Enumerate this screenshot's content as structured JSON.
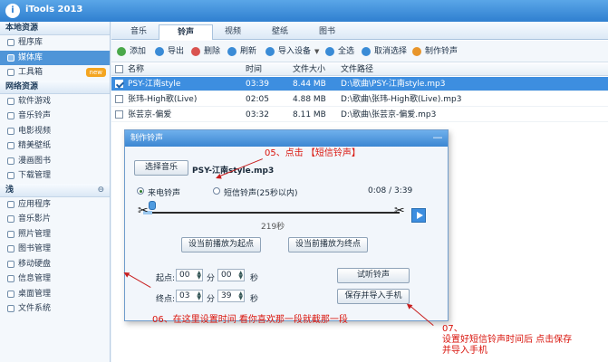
{
  "app": {
    "title": "iTools 2013",
    "logo_icon": "itools-logo"
  },
  "sidebar": {
    "sections": [
      {
        "label": "本地资源",
        "items": [
          {
            "label": "程序库",
            "icon": "app-library-icon",
            "active": false
          },
          {
            "label": "媒体库",
            "icon": "media-library-icon",
            "active": true
          },
          {
            "label": "工具箱",
            "icon": "toolbox-icon",
            "active": false,
            "badge": "new"
          }
        ]
      },
      {
        "label": "网络资源",
        "items": [
          {
            "label": "软件游戏",
            "icon": "games-icon",
            "active": false
          },
          {
            "label": "音乐铃声",
            "icon": "music-ringtone-icon",
            "active": false
          },
          {
            "label": "电影视频",
            "icon": "video-icon",
            "active": false
          },
          {
            "label": "精美壁纸",
            "icon": "wallpaper-icon",
            "active": false
          },
          {
            "label": "漫画图书",
            "icon": "comics-icon",
            "active": false
          },
          {
            "label": "下载管理",
            "icon": "download-icon",
            "active": false
          }
        ]
      },
      {
        "label": "浅",
        "items": [
          {
            "label": "应用程序",
            "icon": "apps-icon",
            "active": false
          },
          {
            "label": "音乐影片",
            "icon": "music-video-icon",
            "active": false
          },
          {
            "label": "照片管理",
            "icon": "photo-icon",
            "active": false
          },
          {
            "label": "图书管理",
            "icon": "book-icon",
            "active": false
          },
          {
            "label": "移动硬盘",
            "icon": "disk-icon",
            "active": false
          },
          {
            "label": "信息管理",
            "icon": "message-icon",
            "active": false
          },
          {
            "label": "桌面管理",
            "icon": "desktop-icon",
            "active": false
          },
          {
            "label": "文件系统",
            "icon": "filesystem-icon",
            "active": false
          }
        ]
      }
    ]
  },
  "tabs": [
    "音乐",
    "铃声",
    "视频",
    "壁纸",
    "图书"
  ],
  "active_tab": "铃声",
  "toolbar": {
    "add": "添加",
    "export": "导出",
    "delete": "删除",
    "refresh": "刷新",
    "import_device": "导入设备",
    "select_all": "全选",
    "deselect": "取消选择",
    "make_ringtone": "制作铃声"
  },
  "table": {
    "headers": [
      "名称",
      "时间",
      "文件大小",
      "文件路径"
    ],
    "rows": [
      {
        "name": "PSY-江南style",
        "time": "03:39",
        "size": "8.44 MB",
        "path": "D:\\歌曲\\PSY-江南style.mp3",
        "selected": true
      },
      {
        "name": "张玮-High歌(Live)",
        "time": "02:05",
        "size": "4.88 MB",
        "path": "D:\\歌曲\\张玮-High歌(Live).mp3",
        "selected": false
      },
      {
        "name": "张芸京-偏爱",
        "time": "03:32",
        "size": "8.11 MB",
        "path": "D:\\歌曲\\张芸京-偏爱.mp3",
        "selected": false
      }
    ]
  },
  "dialog": {
    "title": "制作铃声",
    "close": "—",
    "choose_music": "选择音乐",
    "file_name": "PSY-江南style.mp3",
    "radio_incoming": "来电铃声",
    "radio_sms": "短信铃声(25秒以内)",
    "time_display": "0:08 / 3:39",
    "duration_label": "219秒",
    "slider_value": 0.035,
    "set_start": "设当前播放为起点",
    "set_end": "设当前播放为终点",
    "start_label": "起点:",
    "end_label": "终点:",
    "start_min": "00",
    "start_sec": "00",
    "end_min": "03",
    "end_sec": "39",
    "unit_min": "分",
    "unit_sec": "秒",
    "preview": "试听铃声",
    "save_import": "保存并导入手机"
  },
  "annotations": {
    "step5": "05、点击 【短信铃声】",
    "step6": "06、在这里设置时间 看你喜欢那一段就截那一段",
    "step7_line1": "07、",
    "step7_line2": "设置好短信铃声时间后  点击保存",
    "step7_line3": "并导入手机",
    "color": "#d9140c"
  }
}
